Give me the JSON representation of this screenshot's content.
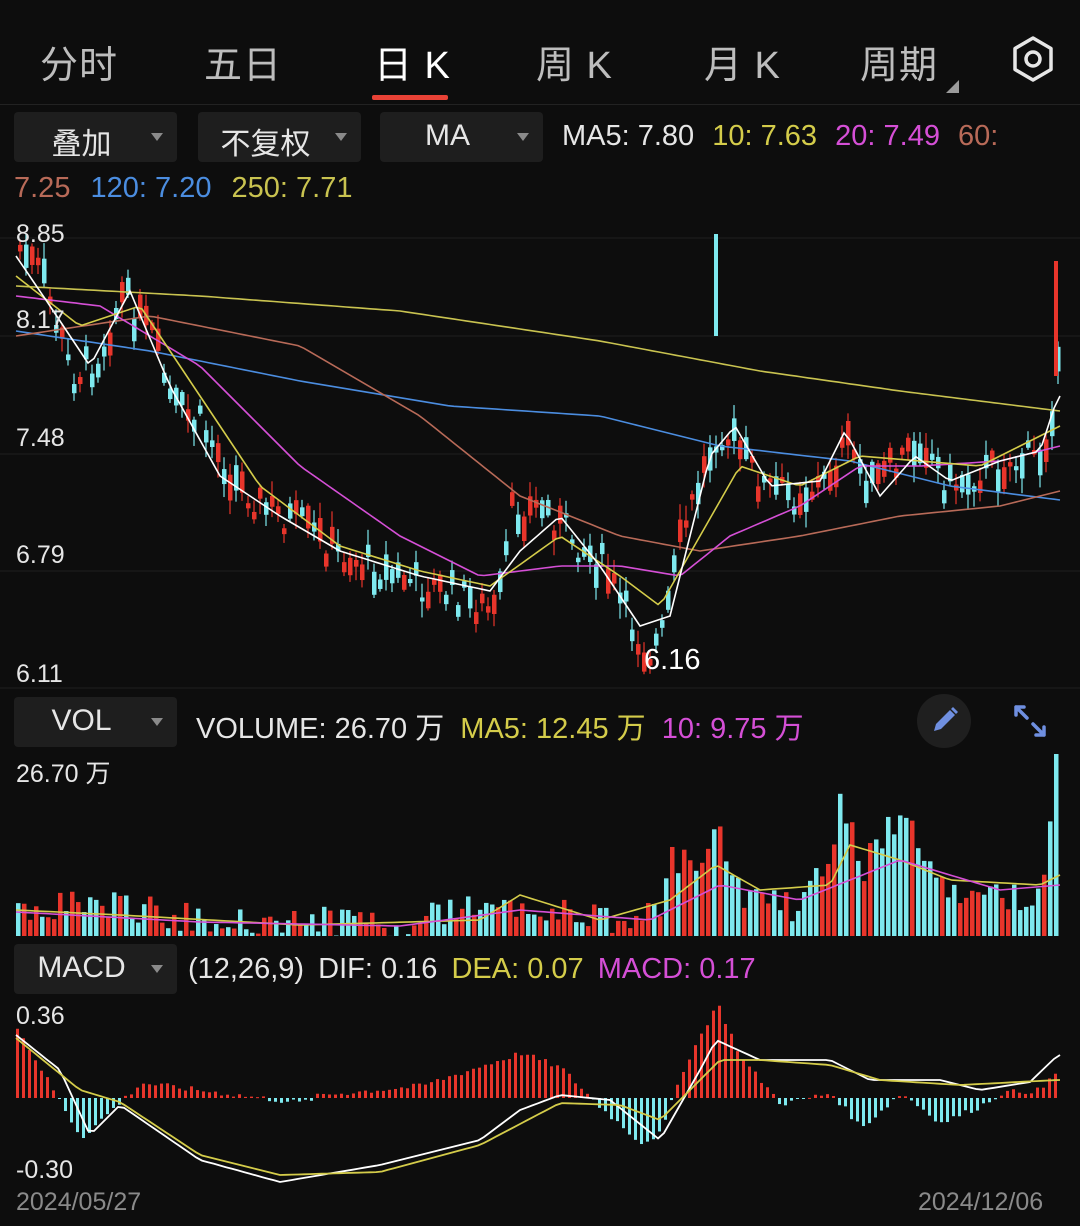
{
  "tabs": {
    "items": [
      "分时",
      "五日",
      "日 K",
      "周 K",
      "月 K",
      "周期"
    ],
    "active_index": 2
  },
  "toolbar": {
    "overlay_label": "叠加",
    "adjust_label": "不复权",
    "indicator_label": "MA"
  },
  "ma_legend": {
    "ma5": "MA5: 7.80",
    "ma10": "10: 7.63",
    "ma20": "20: 7.49",
    "ma60_key": "60:",
    "ma60_val": "7.25",
    "ma120": "120: 7.20",
    "ma250": "250: 7.71"
  },
  "price_axis": {
    "max": "8.85",
    "l2": "8.17",
    "l3": "7.48",
    "l4": "6.79",
    "min": "6.11"
  },
  "low_marker": "6.16",
  "vol_panel": {
    "dropdown": "VOL",
    "volume": "VOLUME: 26.70 万",
    "ma5": "MA5: 12.45 万",
    "ma10": "10: 9.75 万",
    "axis_max": "26.70 万"
  },
  "macd_panel": {
    "dropdown": "MACD",
    "params": "(12,26,9)",
    "dif": "DIF: 0.16",
    "dea": "DEA: 0.07",
    "macd": "MACD: 0.17",
    "axis_max": "0.36",
    "axis_min": "-0.30"
  },
  "dates": {
    "start": "2024/05/27",
    "end": "2024/12/06"
  },
  "icons": [
    "settings-icon",
    "edit-pencil-icon",
    "expand-icon",
    "dropdown-caret-icon"
  ],
  "colors": {
    "up": "#e8352b",
    "down": "#7ee9ef",
    "ma5": "#ffffff",
    "ma10": "#d4cc4a",
    "ma20": "#d54fd6",
    "ma60": "#b86a58",
    "ma120": "#4b8de0",
    "ma250": "#c9c350",
    "accent": "#e84236"
  },
  "chart_data": [
    {
      "type": "candlestick",
      "title": "",
      "y_range": [
        6.11,
        8.85
      ],
      "low_point": 6.16,
      "series": [
        {
          "name": "MA5",
          "last": 7.8
        },
        {
          "name": "MA10",
          "last": 7.63
        },
        {
          "name": "MA20",
          "last": 7.49
        },
        {
          "name": "MA60",
          "last": 7.25
        },
        {
          "name": "MA120",
          "last": 7.2
        },
        {
          "name": "MA250",
          "last": 7.71
        }
      ]
    },
    {
      "type": "bar",
      "title": "",
      "y_max": 26.7,
      "series": [
        {
          "name": "VOLUME",
          "last": 26.7
        },
        {
          "name": "MA5",
          "last": 12.45
        },
        {
          "name": "MA10",
          "last": 9.75
        }
      ]
    },
    {
      "type": "bar",
      "title": "",
      "y_range": [
        -0.3,
        0.36
      ],
      "series": [
        {
          "name": "DIF",
          "last": 0.16
        },
        {
          "name": "DEA",
          "last": 0.07
        },
        {
          "name": "MACD",
          "last": 0.17
        }
      ]
    }
  ]
}
